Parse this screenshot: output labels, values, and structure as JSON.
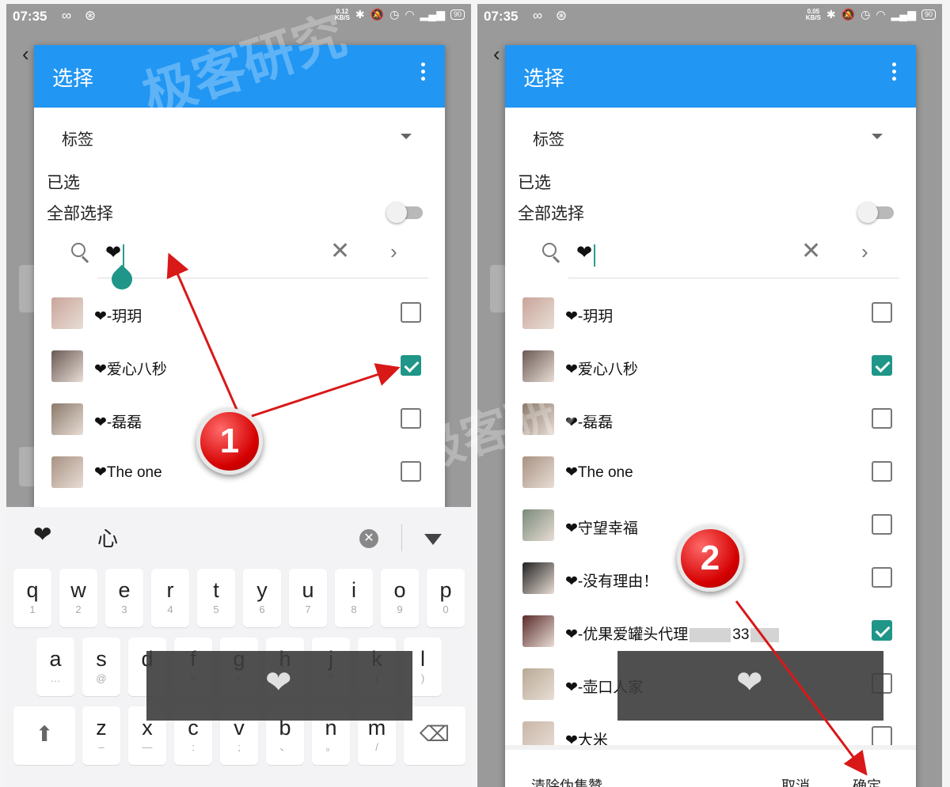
{
  "status_left": {
    "time": "07:35",
    "icons": "∞ ⊛",
    "net_speed_top": "0.12",
    "net_speed_unit": "KB/S",
    "battery": "90"
  },
  "status_right": {
    "time": "07:35",
    "icons": "∞ ⊛",
    "net_speed_top": "0.05",
    "net_speed_unit": "KB/S",
    "battery": "90"
  },
  "dialog": {
    "title": "选择",
    "tag_label": "标签",
    "selected_label": "已选",
    "select_all_label": "全部选择",
    "search_query": "❤",
    "clear_icon": "✕",
    "next_icon": "›"
  },
  "contacts_left": [
    {
      "name": "❤-玥玥",
      "checked": false
    },
    {
      "name": "❤爱心八秒",
      "checked": true
    },
    {
      "name": "❤-磊磊",
      "checked": false
    },
    {
      "name": "❤The one",
      "checked": false
    }
  ],
  "contacts_right": [
    {
      "name": "❤-玥玥",
      "checked": false
    },
    {
      "name": "❤爱心八秒",
      "checked": true
    },
    {
      "name": "❤-磊磊",
      "checked": false
    },
    {
      "name": "❤The one",
      "checked": false
    },
    {
      "name": "❤守望幸福",
      "checked": false
    },
    {
      "name": "❤-没有理由！",
      "checked": false
    },
    {
      "name": "❤-优果爱罐头代理",
      "name_suffix": "33",
      "checked": true
    },
    {
      "name": "❤-壶口人家",
      "checked": false
    },
    {
      "name": "❤大米",
      "checked": false
    }
  ],
  "footer": {
    "clear_label": "清除伪集赞",
    "cancel_label": "取消",
    "confirm_label": "确定"
  },
  "keyboard": {
    "suggestions": [
      "❤",
      "心"
    ],
    "row1": [
      {
        "key": "q",
        "num": "1"
      },
      {
        "key": "w",
        "num": "2"
      },
      {
        "key": "e",
        "num": "3"
      },
      {
        "key": "r",
        "num": "4"
      },
      {
        "key": "t",
        "num": "5"
      },
      {
        "key": "y",
        "num": "6"
      },
      {
        "key": "u",
        "num": "7"
      },
      {
        "key": "i",
        "num": "8"
      },
      {
        "key": "o",
        "num": "9"
      },
      {
        "key": "p",
        "num": "0"
      }
    ],
    "row2": [
      {
        "key": "a",
        "num": "…"
      },
      {
        "key": "s",
        "num": "@"
      },
      {
        "key": "d",
        "num": ""
      },
      {
        "key": "f",
        "num": "#"
      },
      {
        "key": "g",
        "num": "~"
      },
      {
        "key": "h",
        "num": ""
      },
      {
        "key": "j",
        "num": "?"
      },
      {
        "key": "k",
        "num": "("
      },
      {
        "key": "l",
        "num": ")"
      }
    ],
    "row3": [
      {
        "key": "z",
        "num": "–"
      },
      {
        "key": "x",
        "num": "—"
      },
      {
        "key": "c",
        "num": ":"
      },
      {
        "key": "v",
        "num": ";"
      },
      {
        "key": "b",
        "num": "、"
      },
      {
        "key": "n",
        "num": "。"
      },
      {
        "key": "m",
        "num": "/"
      }
    ],
    "shift_icon": "⬆",
    "backspace_icon": "⌫",
    "popup_char": "❤"
  },
  "annotations": {
    "step1": "1",
    "step2": "2",
    "watermark": "极客研究",
    "arrow_color": "#d91818"
  },
  "colors": {
    "header_blue": "#2196f3",
    "checkbox_teal": "#1f9688"
  },
  "icons": {
    "menu": "kebab-icon",
    "search": "search-icon",
    "clear": "close-icon",
    "next": "chevron-right-icon",
    "dropdown": "caret-down-icon"
  }
}
